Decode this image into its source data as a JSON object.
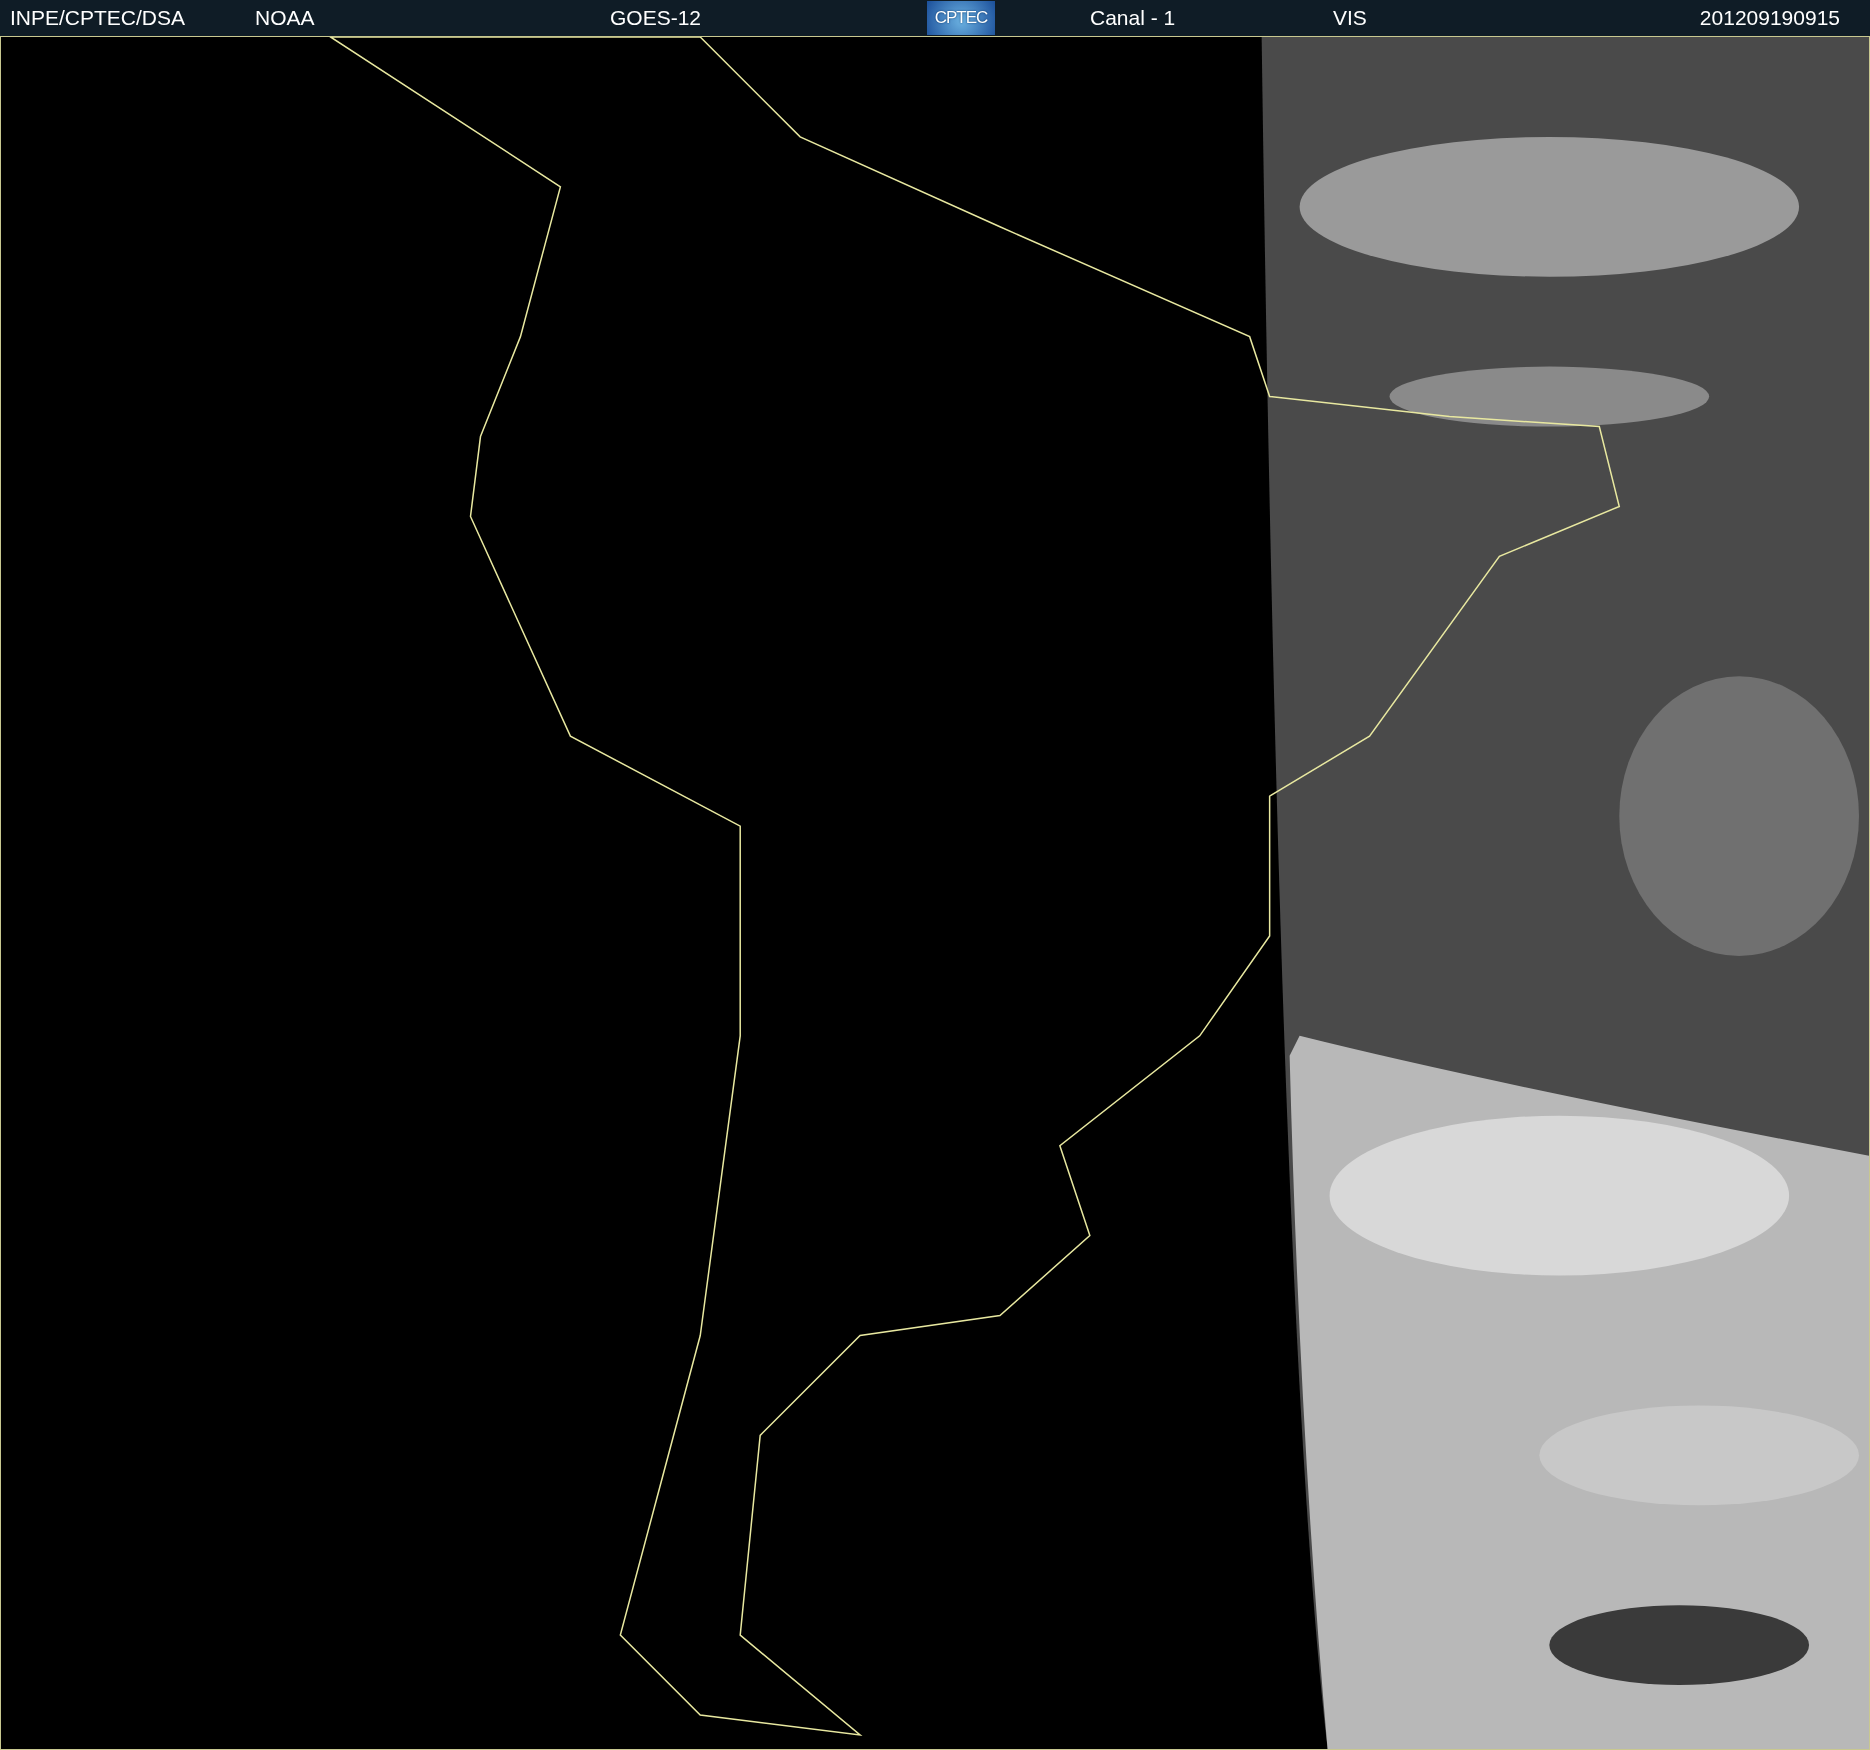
{
  "header": {
    "labels": [
      "INPE/CPTEC/DSA",
      "NOAA",
      "GOES-12"
    ],
    "logo": "CPTEC",
    "channel": "Canal - 1",
    "band": "VIS",
    "timestamp": "201209190915"
  }
}
